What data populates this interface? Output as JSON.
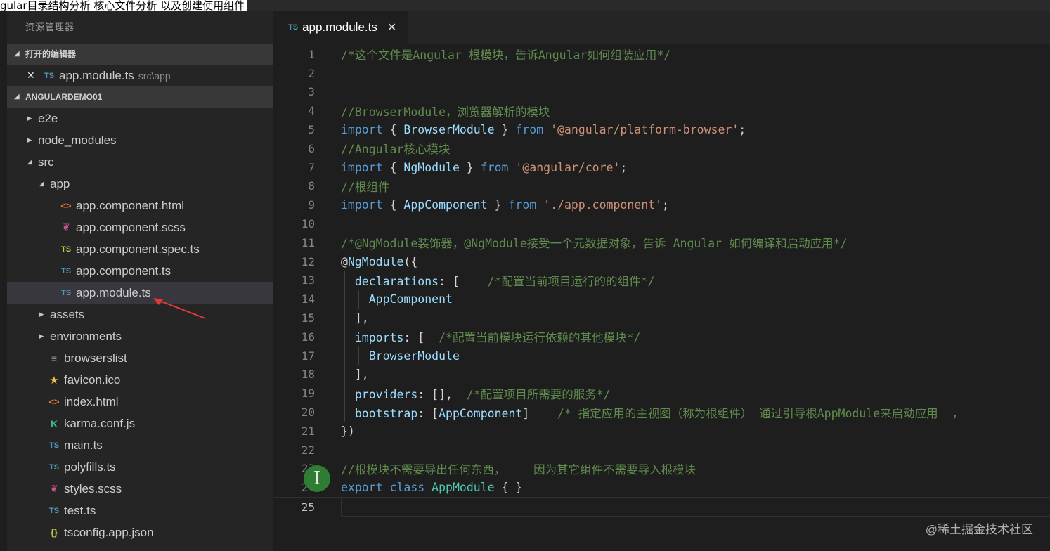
{
  "overlay_title": "gular目录结构分析 核心文件分析 以及创建使用组件",
  "sidebar": {
    "title": "资源管理器",
    "open_editors_header": "打开的编辑器",
    "open_editor": {
      "icon": "TS",
      "name": "app.module.ts",
      "path": "src\\app"
    },
    "project_header": "ANGULARDEMO01",
    "tree": [
      {
        "label": "e2e",
        "type": "folder",
        "depth": 0,
        "expanded": false
      },
      {
        "label": "node_modules",
        "type": "folder",
        "depth": 0,
        "expanded": false
      },
      {
        "label": "src",
        "type": "folder",
        "depth": 0,
        "expanded": true
      },
      {
        "label": "app",
        "type": "folder",
        "depth": 1,
        "expanded": true
      },
      {
        "label": "app.component.html",
        "type": "html",
        "depth": 2
      },
      {
        "label": "app.component.scss",
        "type": "scss",
        "depth": 2
      },
      {
        "label": "app.component.spec.ts",
        "type": "tsspec",
        "depth": 2
      },
      {
        "label": "app.component.ts",
        "type": "ts",
        "depth": 2
      },
      {
        "label": "app.module.ts",
        "type": "ts",
        "depth": 2,
        "selected": true
      },
      {
        "label": "assets",
        "type": "folder",
        "depth": 1,
        "expanded": false
      },
      {
        "label": "environments",
        "type": "folder",
        "depth": 1,
        "expanded": false
      },
      {
        "label": "browserslist",
        "type": "list",
        "depth": 1
      },
      {
        "label": "favicon.ico",
        "type": "star",
        "depth": 1
      },
      {
        "label": "index.html",
        "type": "html",
        "depth": 1
      },
      {
        "label": "karma.conf.js",
        "type": "karma",
        "depth": 1
      },
      {
        "label": "main.ts",
        "type": "ts",
        "depth": 1
      },
      {
        "label": "polyfills.ts",
        "type": "ts",
        "depth": 1
      },
      {
        "label": "styles.scss",
        "type": "scss",
        "depth": 1
      },
      {
        "label": "test.ts",
        "type": "ts",
        "depth": 1
      },
      {
        "label": "tsconfig.app.json",
        "type": "json",
        "depth": 1
      }
    ]
  },
  "editor": {
    "tab": {
      "icon": "TS",
      "name": "app.module.ts"
    },
    "active_line": 25,
    "lines": [
      [
        [
          "com",
          "/*这个文件是Angular 根模块，告诉Angular如何组装应用*/"
        ]
      ],
      [],
      [],
      [
        [
          "com",
          "//BrowserModule，浏览器解析的模块"
        ]
      ],
      [
        [
          "kw",
          "import"
        ],
        [
          "p",
          " { "
        ],
        [
          "id",
          "BrowserModule"
        ],
        [
          "p",
          " } "
        ],
        [
          "kw",
          "from"
        ],
        [
          "p",
          " "
        ],
        [
          "str",
          "'@angular/platform-browser'"
        ],
        [
          "p",
          ";"
        ]
      ],
      [
        [
          "com",
          "//Angular核心模块"
        ]
      ],
      [
        [
          "kw",
          "import"
        ],
        [
          "p",
          " { "
        ],
        [
          "id",
          "NgModule"
        ],
        [
          "p",
          " } "
        ],
        [
          "kw",
          "from"
        ],
        [
          "p",
          " "
        ],
        [
          "str",
          "'@angular/core'"
        ],
        [
          "p",
          ";"
        ]
      ],
      [
        [
          "com",
          "//根组件"
        ]
      ],
      [
        [
          "kw",
          "import"
        ],
        [
          "p",
          " { "
        ],
        [
          "id",
          "AppComponent"
        ],
        [
          "p",
          " } "
        ],
        [
          "kw",
          "from"
        ],
        [
          "p",
          " "
        ],
        [
          "str",
          "'./app.component'"
        ],
        [
          "p",
          ";"
        ]
      ],
      [],
      [
        [
          "com",
          "/*@NgModule装饰器，@NgModule接受一个元数据对象，告诉 Angular 如何编译和启动应用*/"
        ]
      ],
      [
        [
          "p",
          "@"
        ],
        [
          "id",
          "NgModule"
        ],
        [
          "p",
          "({"
        ]
      ],
      [
        [
          "p",
          "  "
        ],
        [
          "prop",
          "declarations"
        ],
        [
          "p",
          ": [    "
        ],
        [
          "com",
          "/*配置当前项目运行的的组件*/"
        ]
      ],
      [
        [
          "p",
          "    "
        ],
        [
          "id",
          "AppComponent"
        ]
      ],
      [
        [
          "p",
          "  ],"
        ]
      ],
      [
        [
          "p",
          "  "
        ],
        [
          "prop",
          "imports"
        ],
        [
          "p",
          ": [  "
        ],
        [
          "com",
          "/*配置当前模块运行依赖的其他模块*/"
        ]
      ],
      [
        [
          "p",
          "    "
        ],
        [
          "id",
          "BrowserModule"
        ]
      ],
      [
        [
          "p",
          "  ],"
        ]
      ],
      [
        [
          "p",
          "  "
        ],
        [
          "prop",
          "providers"
        ],
        [
          "p",
          ": [],  "
        ],
        [
          "com",
          "/*配置项目所需要的服务*/"
        ]
      ],
      [
        [
          "p",
          "  "
        ],
        [
          "prop",
          "bootstrap"
        ],
        [
          "p",
          ": ["
        ],
        [
          "id",
          "AppComponent"
        ],
        [
          "p",
          "]    "
        ],
        [
          "com",
          "/* 指定应用的主视图（称为根组件） 通过引导根AppModule来启动应用  ，"
        ]
      ],
      [
        [
          "p",
          "})"
        ]
      ],
      [],
      [
        [
          "com",
          "//根模块不需要导出任何东西，    因为其它组件不需要导入根模块"
        ]
      ],
      [
        [
          "kw",
          "export"
        ],
        [
          "p",
          " "
        ],
        [
          "kw",
          "class"
        ],
        [
          "p",
          " "
        ],
        [
          "cls",
          "AppModule"
        ],
        [
          "p",
          " { }"
        ]
      ],
      []
    ]
  },
  "cursor_glyph": "I",
  "watermark": "@稀土掘金技术社区",
  "colors": {
    "comment": "#608b4e",
    "keyword": "#569cd6",
    "identifier": "#9cdcfe",
    "string": "#ce9178",
    "class": "#4ec9b0",
    "annotation_arrow": "#e53935"
  }
}
